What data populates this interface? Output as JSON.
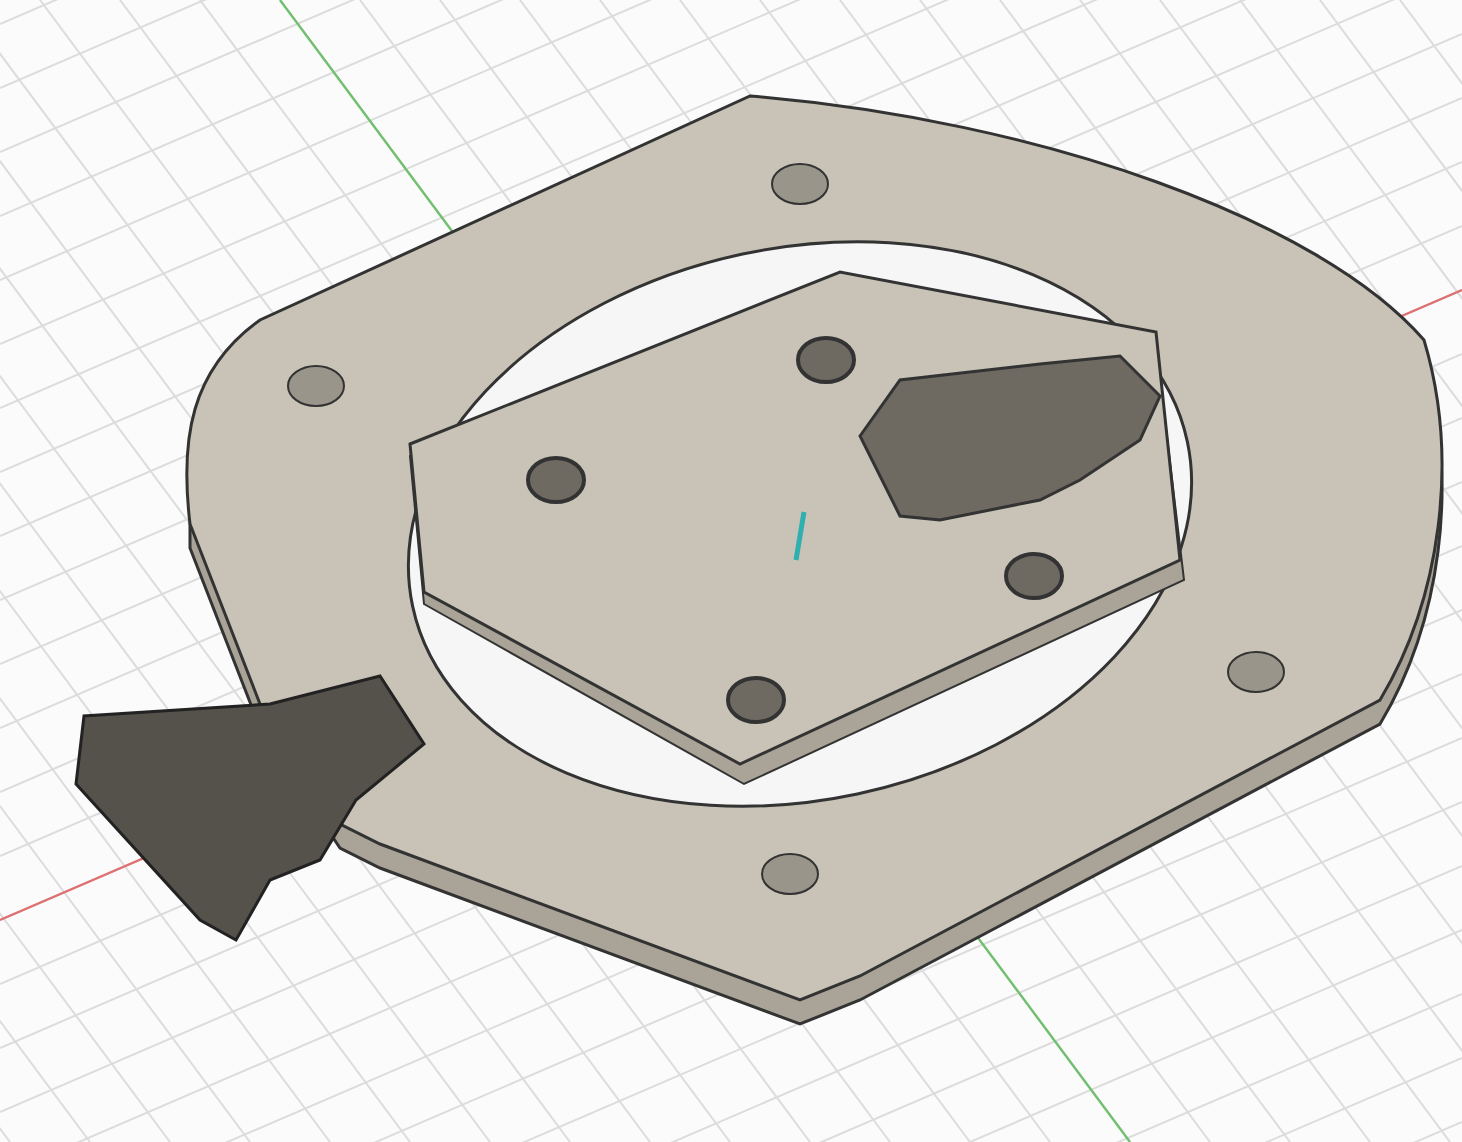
{
  "viewport": {
    "kind": "model",
    "axes": [
      {
        "kind": "xaxis",
        "color": "#e07070"
      },
      {
        "kind": "yaxis",
        "color": "#70c070"
      }
    ]
  }
}
